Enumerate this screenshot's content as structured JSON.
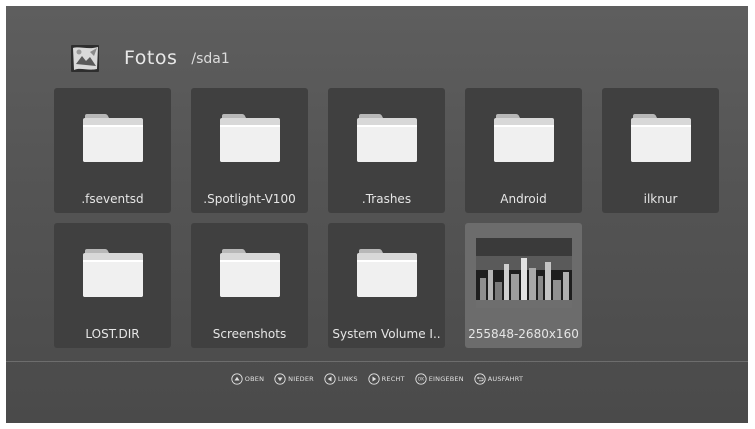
{
  "header": {
    "title": "Fotos",
    "path": "/sda1",
    "icon": "photos-app-icon"
  },
  "items": [
    {
      "label": ".fseventsd",
      "type": "folder"
    },
    {
      "label": ".Spotlight-V100",
      "type": "folder"
    },
    {
      "label": ".Trashes",
      "type": "folder"
    },
    {
      "label": "Android",
      "type": "folder"
    },
    {
      "label": "ilknur",
      "type": "folder"
    },
    {
      "label": "LOST.DIR",
      "type": "folder"
    },
    {
      "label": "Screenshots",
      "type": "folder"
    },
    {
      "label": "System Volume I..",
      "type": "folder"
    },
    {
      "label": "255848-2680x160",
      "type": "image",
      "selected": true
    }
  ],
  "hints": [
    {
      "label": "OBEN",
      "icon": "up-arrow-icon"
    },
    {
      "label": "NIEDER",
      "icon": "down-arrow-icon"
    },
    {
      "label": "LINKS",
      "icon": "left-arrow-icon"
    },
    {
      "label": "RECHT",
      "icon": "right-arrow-icon"
    },
    {
      "label": "EINGEBEN",
      "icon": "ok-icon",
      "glyph": "OK"
    },
    {
      "label": "AUSFAHRT",
      "icon": "back-icon"
    }
  ],
  "colors": {
    "background": "#555555",
    "tile": "#404040",
    "tile_selected": "#6c6c6c"
  }
}
